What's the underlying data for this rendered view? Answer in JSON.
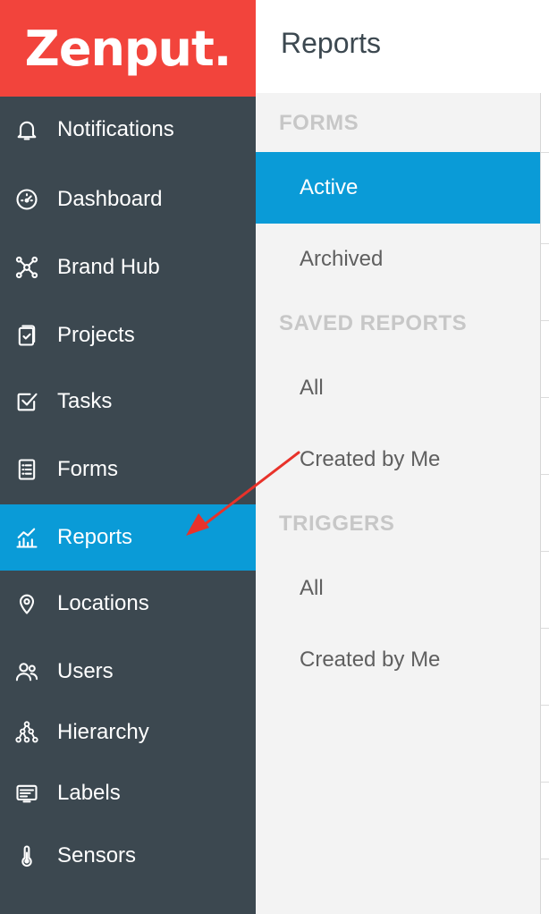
{
  "brand": {
    "logo_text": "Zenput."
  },
  "header": {
    "title": "Reports"
  },
  "sidebar": {
    "items": [
      {
        "label": "Notifications",
        "icon": "bell-icon",
        "active": false
      },
      {
        "label": "Dashboard",
        "icon": "gauge-icon",
        "active": false
      },
      {
        "label": "Brand Hub",
        "icon": "hub-icon",
        "active": false
      },
      {
        "label": "Projects",
        "icon": "clipboard-icon",
        "active": false
      },
      {
        "label": "Tasks",
        "icon": "checkbox-icon",
        "active": false
      },
      {
        "label": "Forms",
        "icon": "document-icon",
        "active": false
      },
      {
        "label": "Reports",
        "icon": "chart-icon",
        "active": true
      },
      {
        "label": "Locations",
        "icon": "location-pin-icon",
        "active": false
      },
      {
        "label": "Users",
        "icon": "users-icon",
        "active": false
      },
      {
        "label": "Hierarchy",
        "icon": "hierarchy-icon",
        "active": false
      },
      {
        "label": "Labels",
        "icon": "label-icon",
        "active": false
      },
      {
        "label": "Sensors",
        "icon": "thermometer-icon",
        "active": false
      }
    ]
  },
  "submenu": {
    "forms": {
      "title": "FORMS",
      "items": [
        "Active",
        "Archived"
      ],
      "active": "Active"
    },
    "saved_reports": {
      "title": "SAVED REPORTS",
      "items": [
        "All",
        "Created by Me"
      ]
    },
    "triggers": {
      "title": "TRIGGERS",
      "items": [
        "All",
        "Created by Me"
      ]
    }
  },
  "colors": {
    "brand_red": "#f2443c",
    "sidebar_bg": "#3c4850",
    "accent_blue": "#0a9bd7",
    "panel_bg": "#f3f3f3",
    "annotation_arrow": "#e8322a"
  }
}
